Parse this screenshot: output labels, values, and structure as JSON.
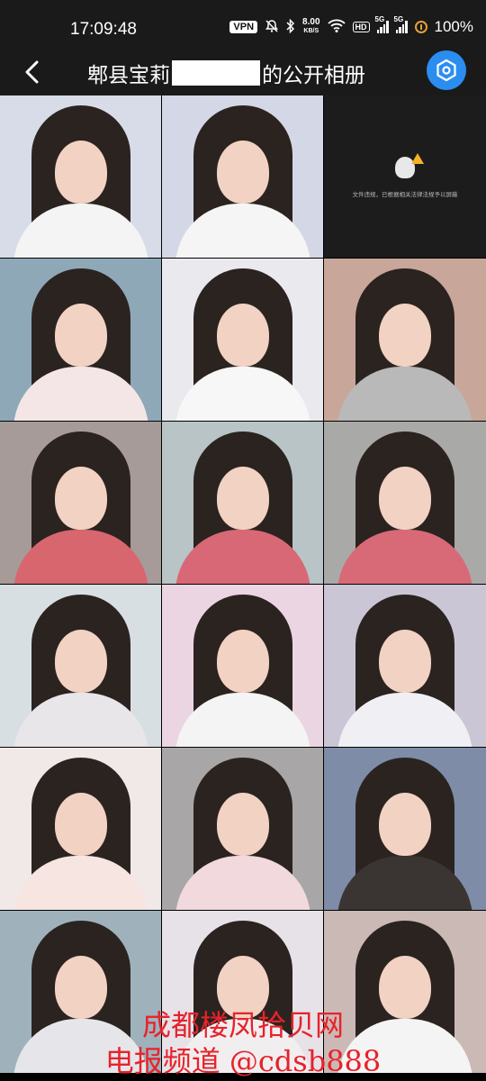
{
  "status_bar": {
    "time": "17:09:48",
    "vpn": "VPN",
    "net_speed_value": "8.00",
    "net_speed_unit": "KB/S",
    "hd": "HD",
    "sim1": "5G",
    "sim2": "5G",
    "battery": "100%"
  },
  "header": {
    "title_prefix": "郫县宝莉",
    "title_suffix": "的公开相册"
  },
  "blocked_tile": {
    "message": "文件违规，已根据相关法律法规予以屏蔽"
  },
  "photos": [
    {
      "bg": "#d8dbe8",
      "body": "#f4f4f4"
    },
    {
      "bg": "#d4d8e6",
      "body": "#f5f5f5"
    },
    {
      "blocked": true
    },
    {
      "bg": "#8fa8b8",
      "body": "#f4e6e6"
    },
    {
      "bg": "#e9e9ee",
      "body": "#f7f7f7"
    },
    {
      "bg": "#c9a69a",
      "body": "#b9b9b9"
    },
    {
      "bg": "#a69b99",
      "body": "#d8666f"
    },
    {
      "bg": "#b8c4c6",
      "body": "#d86876"
    },
    {
      "bg": "#a9aaa8",
      "body": "#d86a78"
    },
    {
      "bg": "#d8dfe3",
      "body": "#e9e6ea"
    },
    {
      "bg": "#ecd5e2",
      "body": "#f4f4f4"
    },
    {
      "bg": "#cbc6d6",
      "body": "#f0f0f4"
    },
    {
      "bg": "#f1e9e7",
      "body": "#f7e5e2"
    },
    {
      "bg": "#a8a6a6",
      "body": "#f1d9de"
    },
    {
      "bg": "#7e8ca8",
      "body": "#3a3533"
    },
    {
      "bg": "#9fb2bc",
      "body": "#e6e6ea"
    },
    {
      "bg": "#e6e2e8",
      "body": "#f1eef0"
    },
    {
      "bg": "#cbb9b6",
      "body": "#f4f4f4"
    }
  ],
  "watermark": {
    "line1": "成都楼凤拾贝网",
    "line2": "电报频道 @cdsb888"
  },
  "colors": {
    "accent": "#2c8df0",
    "watermark": "#e8222a",
    "battery": "#e2a23b"
  }
}
